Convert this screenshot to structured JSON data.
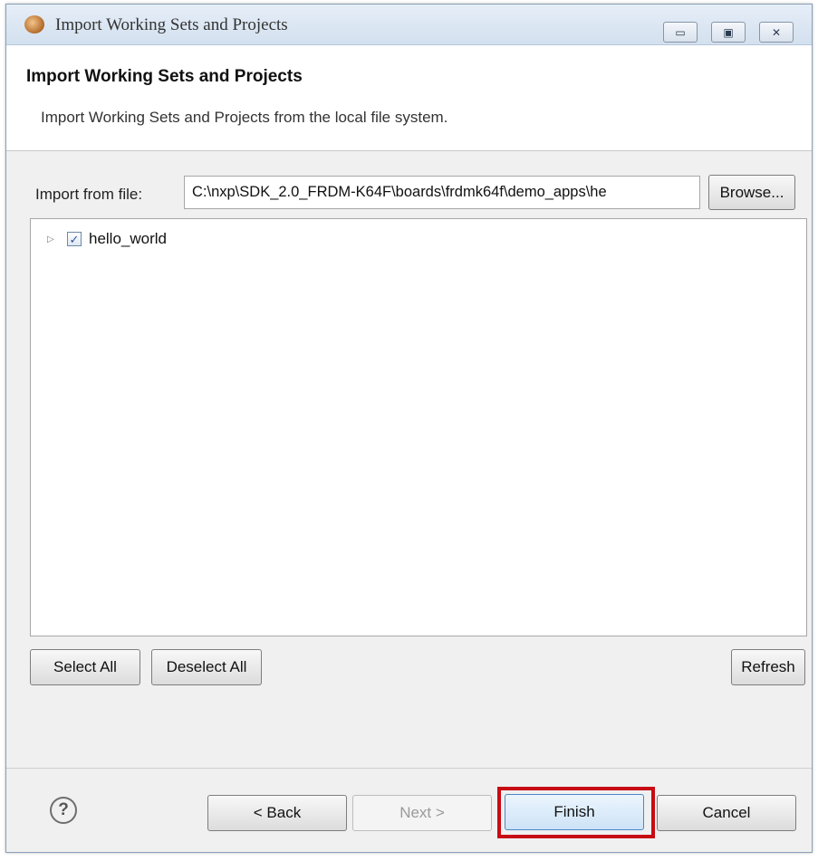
{
  "window": {
    "title": "Import Working Sets and Projects",
    "controls": {
      "minimize": "▭",
      "maximize": "▣",
      "close": "✕"
    }
  },
  "header": {
    "title": "Import Working Sets and Projects",
    "description": "Import Working Sets and Projects from the local file system."
  },
  "import": {
    "label": "Import from file:",
    "path": "C:\\nxp\\SDK_2.0_FRDM-K64F\\boards\\frdmk64f\\demo_apps\\he",
    "browse_label": "Browse..."
  },
  "tree": {
    "items": [
      {
        "label": "hello_world",
        "checked": true,
        "expander": "▷",
        "check_mark": "✓"
      }
    ]
  },
  "selection": {
    "select_all_label": "Select All",
    "deselect_all_label": "Deselect All",
    "refresh_label": "Refresh"
  },
  "footer": {
    "help_label": "?",
    "back_label": "< Back",
    "next_label": "Next >",
    "finish_label": "Finish",
    "cancel_label": "Cancel",
    "highlight_color": "#c80c14"
  }
}
